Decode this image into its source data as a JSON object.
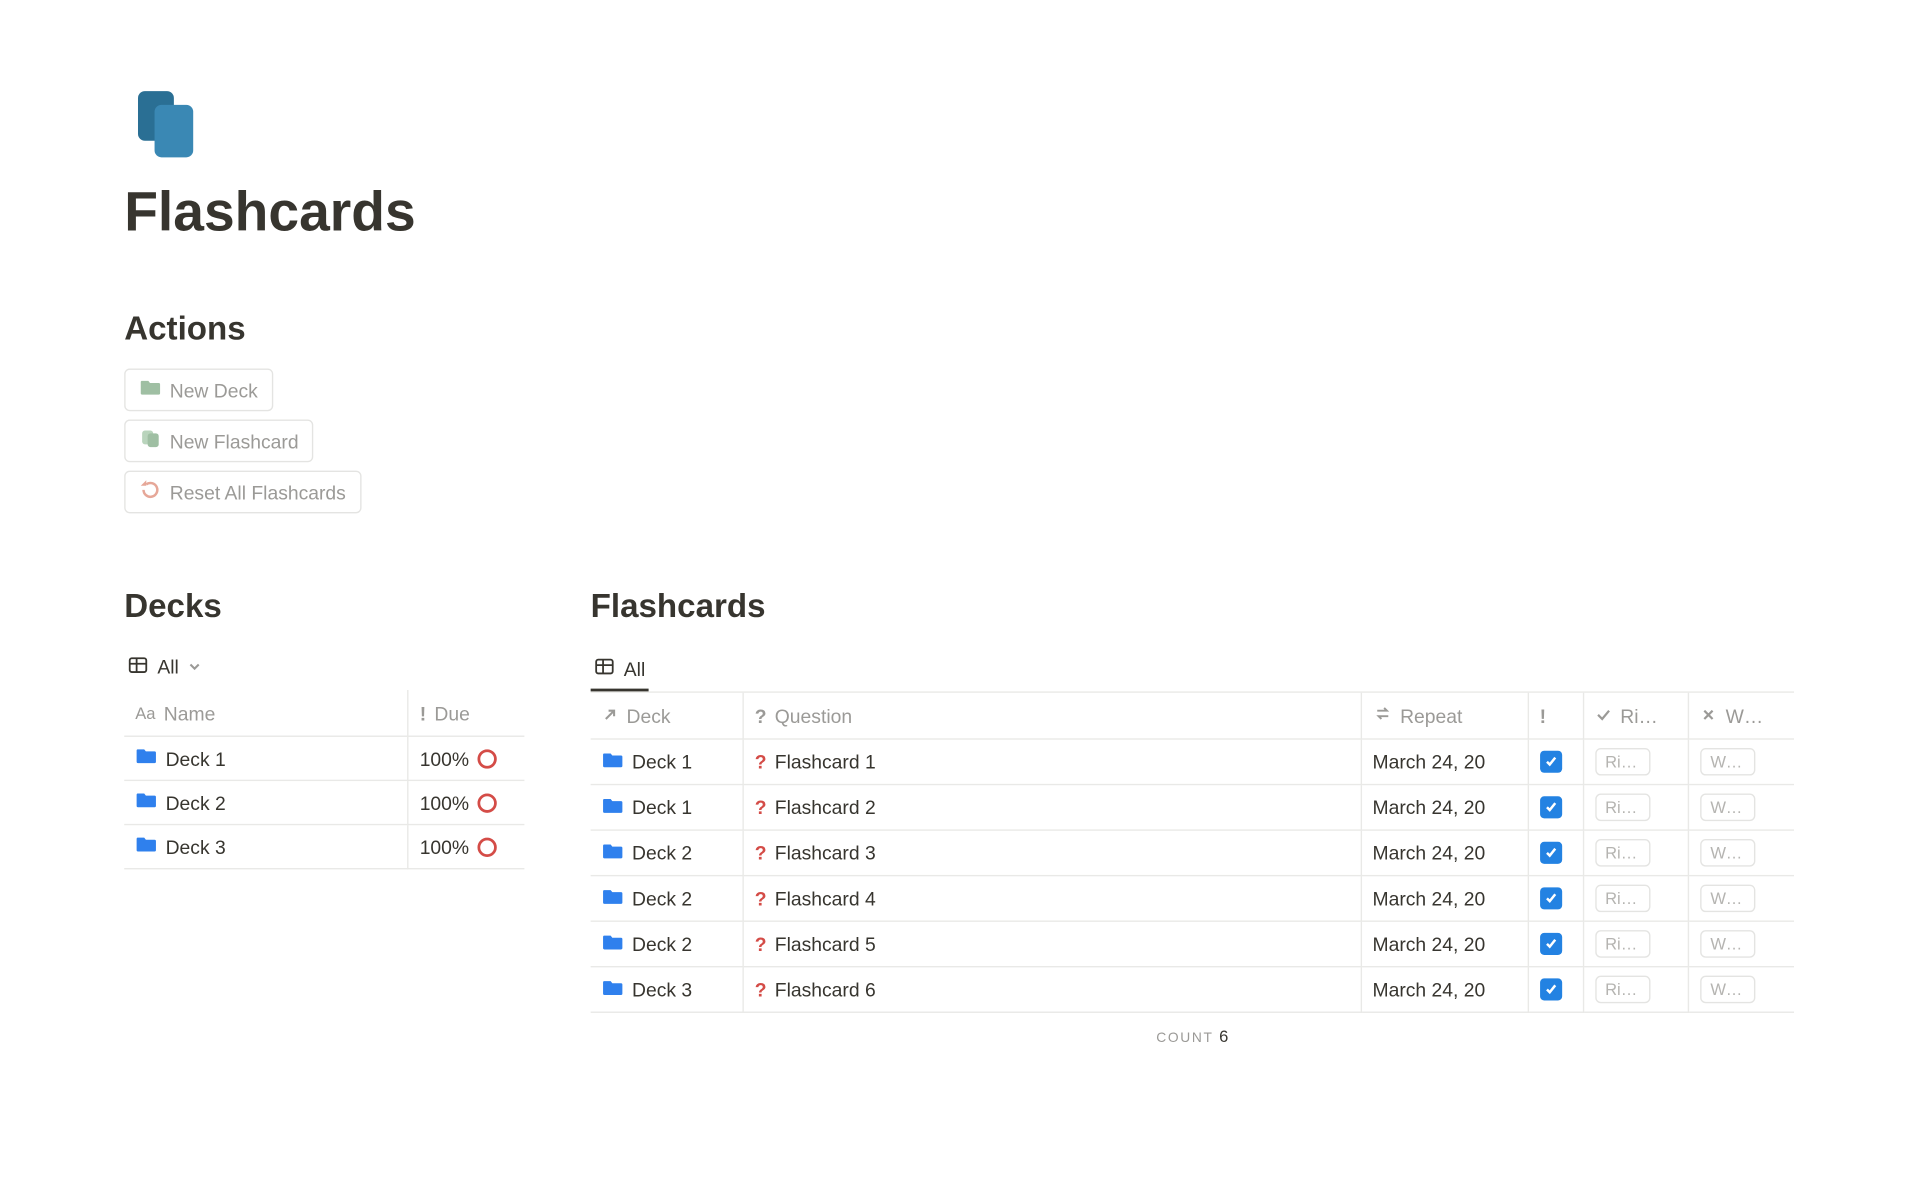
{
  "page": {
    "title": "Flashcards"
  },
  "actions": {
    "heading": "Actions",
    "buttons": {
      "new_deck": "New Deck",
      "new_flashcard": "New Flashcard",
      "reset_all": "Reset All Flashcards"
    }
  },
  "decks": {
    "heading": "Decks",
    "view_label": "All",
    "columns": {
      "name": "Name",
      "due": "Due"
    },
    "rows": [
      {
        "name": "Deck 1",
        "due": "100%"
      },
      {
        "name": "Deck 2",
        "due": "100%"
      },
      {
        "name": "Deck 3",
        "due": "100%"
      }
    ]
  },
  "flashcards": {
    "heading": "Flashcards",
    "view_label": "All",
    "columns": {
      "deck": "Deck",
      "question": "Question",
      "repeat": "Repeat",
      "bang": "",
      "right": "Ri…",
      "wrong": "W…"
    },
    "rows": [
      {
        "deck": "Deck 1",
        "question": "Flashcard 1",
        "repeat": "March 24, 20",
        "checked": true,
        "right": "Right",
        "wrong": "Wro…"
      },
      {
        "deck": "Deck 1",
        "question": "Flashcard 2",
        "repeat": "March 24, 20",
        "checked": true,
        "right": "Right",
        "wrong": "Wro…"
      },
      {
        "deck": "Deck 2",
        "question": "Flashcard 3",
        "repeat": "March 24, 20",
        "checked": true,
        "right": "Right",
        "wrong": "Wro…"
      },
      {
        "deck": "Deck 2",
        "question": "Flashcard 4",
        "repeat": "March 24, 20",
        "checked": true,
        "right": "Right",
        "wrong": "Wro…"
      },
      {
        "deck": "Deck 2",
        "question": "Flashcard 5",
        "repeat": "March 24, 20",
        "checked": true,
        "right": "Right",
        "wrong": "Wro…"
      },
      {
        "deck": "Deck 3",
        "question": "Flashcard 6",
        "repeat": "March 24, 20",
        "checked": true,
        "right": "Right",
        "wrong": "Wro…"
      }
    ],
    "count_label": "COUNT",
    "count_value": "6"
  }
}
